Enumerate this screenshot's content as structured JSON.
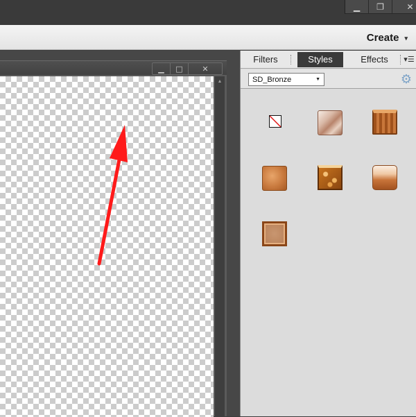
{
  "window": {
    "minimize_glyph": "▁",
    "restore_glyph": "❐",
    "close_glyph": "✕"
  },
  "menubar": {
    "create_label": "Create",
    "create_caret": "▾"
  },
  "document": {
    "minimize_glyph": "▁",
    "maximize_glyph": "□",
    "close_glyph": "✕",
    "scroll_up_glyph": "▲",
    "annotation_arrow_color": "#ff1a1a"
  },
  "panel": {
    "tabs": [
      {
        "label": "Filters",
        "active": false
      },
      {
        "label": "Styles",
        "active": true
      },
      {
        "label": "Effects",
        "active": false
      }
    ],
    "menu_glyph": "▾☰",
    "library_dropdown": {
      "selected": "SD_Bronze",
      "caret": "▼"
    },
    "gear_glyph": "⚙",
    "style_thumbnails": [
      {
        "icon": "no-style-icon"
      },
      {
        "icon": "bronze-style-1"
      },
      {
        "icon": "bronze-style-2"
      },
      {
        "icon": "bronze-style-3"
      },
      {
        "icon": "bronze-style-4"
      },
      {
        "icon": "bronze-style-5"
      },
      {
        "icon": "bronze-style-6"
      }
    ],
    "colors": {
      "active_tab_bg": "#3a3a3a",
      "panel_bg": "#dcdcdc",
      "gear": "#7ea4c8"
    }
  }
}
